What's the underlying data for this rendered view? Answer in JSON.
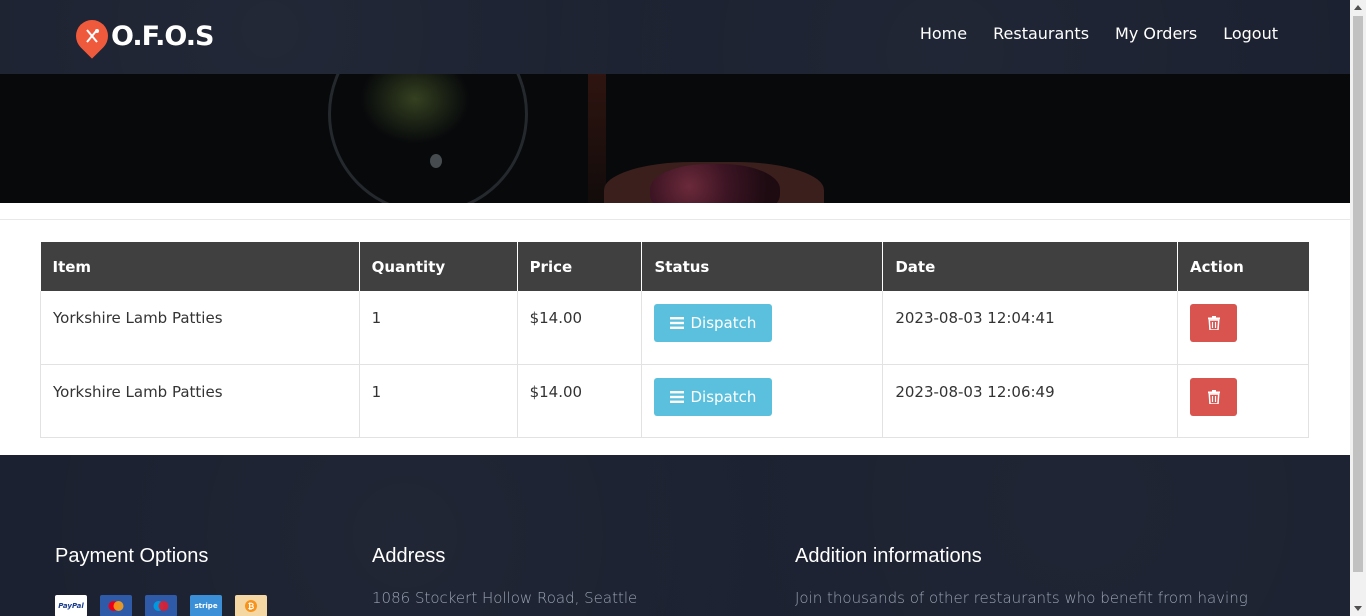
{
  "brand": {
    "name": "O.F.O.S"
  },
  "nav": {
    "home": "Home",
    "restaurants": "Restaurants",
    "my_orders": "My Orders",
    "logout": "Logout"
  },
  "table": {
    "headers": {
      "item": "Item",
      "quantity": "Quantity",
      "price": "Price",
      "status": "Status",
      "date": "Date",
      "action": "Action"
    },
    "rows": [
      {
        "item": "Yorkshire Lamb Patties",
        "quantity": "1",
        "price": "$14.00",
        "status": "Dispatch",
        "date": "2023-08-03 12:04:41"
      },
      {
        "item": "Yorkshire Lamb Patties",
        "quantity": "1",
        "price": "$14.00",
        "status": "Dispatch",
        "date": "2023-08-03 12:06:49"
      }
    ]
  },
  "footer": {
    "payment_title": "Payment Options",
    "payment_methods": [
      "PayPal",
      "Mastercard",
      "Maestro",
      "stripe",
      "Bitcoin"
    ],
    "address_title": "Address",
    "address_text": "1086 Stockert Hollow Road, Seattle",
    "info_title": "Addition informations",
    "info_text": "Join thousands of other restaurants who benefit from having partnered with us."
  },
  "colors": {
    "navbar": "#1b2130",
    "dispatch": "#5bc0de",
    "delete": "#d9534f",
    "brand_mark": "#ef5a3c",
    "table_header": "#404040"
  },
  "icons": {
    "brand": "utensils-logo-icon",
    "status": "bars-icon",
    "delete": "trash-icon"
  }
}
